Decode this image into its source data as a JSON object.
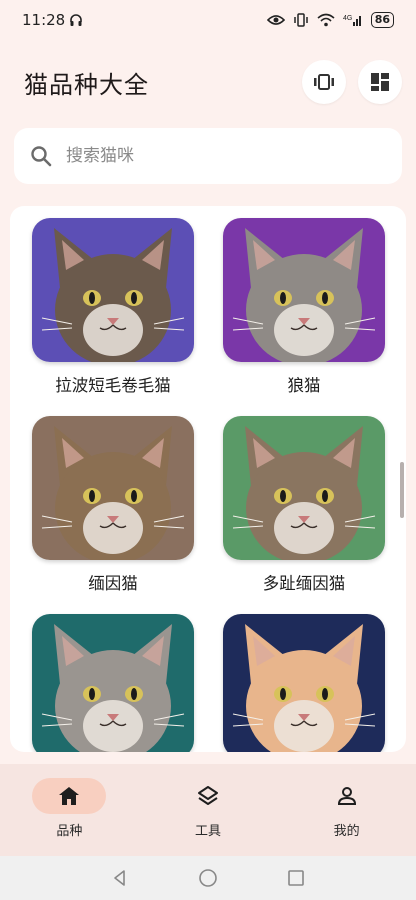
{
  "status": {
    "time": "11:28",
    "battery": "86",
    "network": "4G"
  },
  "header": {
    "title": "猫品种大全"
  },
  "search": {
    "placeholder": "搜索猫咪"
  },
  "breeds": [
    {
      "name": "拉波短毛卷毛猫",
      "bg": "#5c4fb5",
      "fur": "#6b5a4c",
      "icon": "cat-photo"
    },
    {
      "name": "狼猫",
      "bg": "#7a37a8",
      "fur": "#8f8a86",
      "icon": "cat-photo"
    },
    {
      "name": "缅因猫",
      "bg": "#8a705f",
      "fur": "#8b6f52",
      "icon": "cat-photo"
    },
    {
      "name": "多趾缅因猫",
      "bg": "#5a9a67",
      "fur": "#8a7560",
      "icon": "cat-photo"
    },
    {
      "name": "",
      "bg": "#1f6b6b",
      "fur": "#9a9590",
      "icon": "cat-photo"
    },
    {
      "name": "",
      "bg": "#1e2b5a",
      "fur": "#e8b58c",
      "icon": "cat-photo"
    }
  ],
  "nav": [
    {
      "label": "品种",
      "icon": "home-icon",
      "active": true
    },
    {
      "label": "工具",
      "icon": "layers-icon",
      "active": false
    },
    {
      "label": "我的",
      "icon": "person-icon",
      "active": false
    }
  ],
  "colors": {
    "accent": "#f8cfc0",
    "background": "#fdf1ee",
    "nav_bg": "#f6e5e1"
  }
}
